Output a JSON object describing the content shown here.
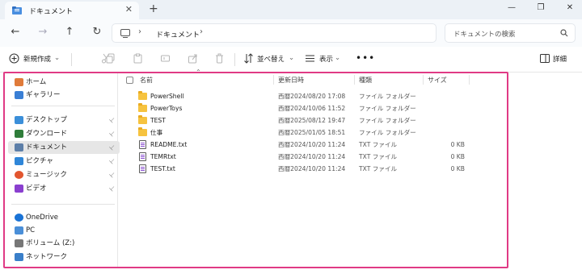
{
  "window": {
    "tab_title": "ドキュメント",
    "tab_close": "✕",
    "new_tab": "+",
    "controls": {
      "minimize": "—",
      "maximize": "❐",
      "close": "✕"
    }
  },
  "nav": {
    "back": "←",
    "forward": "→",
    "up": "↑",
    "refresh": "↻",
    "breadcrumb": [
      "ドキュメント"
    ],
    "chevron": "›",
    "search_placeholder": "ドキュメントの検索"
  },
  "toolbar": {
    "new_label": "新規作成",
    "sort_label": "並べ替え",
    "view_label": "表示",
    "more": "•••",
    "details_label": "詳細"
  },
  "sidebar": {
    "groups": [
      [
        {
          "label": "ホーム",
          "icon": "home-icon",
          "pinned": false
        },
        {
          "label": "ギャラリー",
          "icon": "gallery-icon",
          "pinned": false
        }
      ],
      [
        {
          "label": "デスクトップ",
          "icon": "desktop-icon",
          "pinned": true
        },
        {
          "label": "ダウンロード",
          "icon": "download-icon",
          "pinned": true
        },
        {
          "label": "ドキュメント",
          "icon": "documents-icon",
          "pinned": true,
          "selected": true
        },
        {
          "label": "ピクチャ",
          "icon": "pictures-icon",
          "pinned": true
        },
        {
          "label": "ミュージック",
          "icon": "music-icon",
          "pinned": true
        },
        {
          "label": "ビデオ",
          "icon": "videos-icon",
          "pinned": true
        }
      ],
      [
        {
          "label": "OneDrive",
          "icon": "onedrive-icon",
          "pinned": false
        },
        {
          "label": "PC",
          "icon": "pc-icon",
          "pinned": false
        },
        {
          "label": "ボリューム (Z:)",
          "icon": "drive-icon",
          "pinned": false
        },
        {
          "label": "ネットワーク",
          "icon": "network-icon",
          "pinned": false
        }
      ]
    ],
    "pin_glyph": "📌"
  },
  "table": {
    "columns": [
      "名前",
      "更新日時",
      "種類",
      "サイズ"
    ],
    "rows": [
      {
        "name": "PowerShell",
        "date": "西暦2024/08/20 17:08",
        "type": "ファイル フォルダー",
        "size": "",
        "kind": "folder"
      },
      {
        "name": "PowerToys",
        "date": "西暦2024/10/06 11:52",
        "type": "ファイル フォルダー",
        "size": "",
        "kind": "folder"
      },
      {
        "name": "TEST",
        "date": "西暦2025/08/12 19:47",
        "type": "ファイル フォルダー",
        "size": "",
        "kind": "folder"
      },
      {
        "name": "仕事",
        "date": "西暦2025/01/05 18:51",
        "type": "ファイル フォルダー",
        "size": "",
        "kind": "folder"
      },
      {
        "name": "README.txt",
        "date": "西暦2024/10/20 11:24",
        "type": "TXT ファイル",
        "size": "0 KB",
        "kind": "txt"
      },
      {
        "name": "TEMRtxt",
        "date": "西暦2024/10/20 11:24",
        "type": "TXT ファイル",
        "size": "0 KB",
        "kind": "txt"
      },
      {
        "name": "TEST.txt",
        "date": "西暦2024/10/20 11:24",
        "type": "TXT ファイル",
        "size": "0 KB",
        "kind": "txt"
      }
    ]
  },
  "colors": {
    "highlight": "#e03a85",
    "folder": "#f6c33f",
    "selected_bg": "#e6e6e6"
  }
}
